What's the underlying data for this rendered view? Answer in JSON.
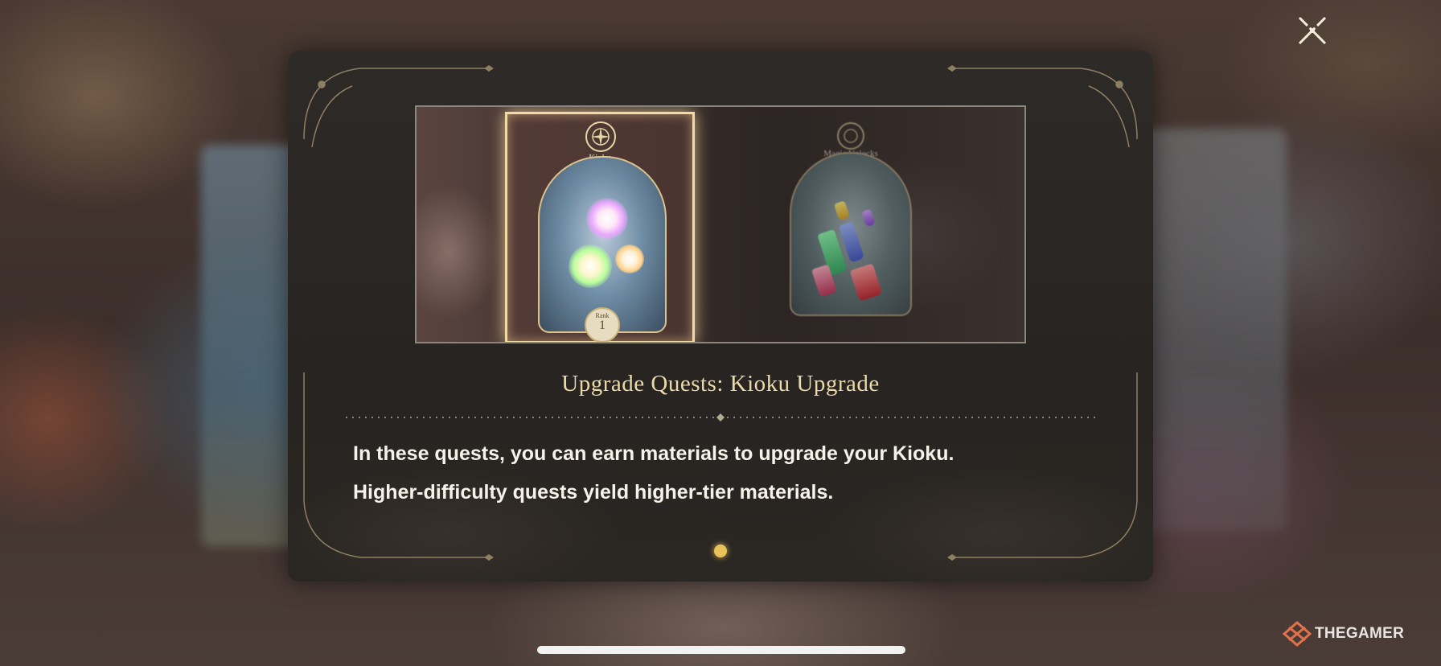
{
  "dialog": {
    "close_icon": "close-x-icon",
    "images": {
      "active_card": {
        "title": "Kioku",
        "rank_label": "Rank",
        "rank_value": "1"
      },
      "faded_card": {
        "title": "Magic Unlocks"
      }
    },
    "quest_title": "Upgrade Quests: Kioku Upgrade",
    "description": [
      "In these quests, you can earn materials to upgrade your Kioku.",
      "Higher-difficulty quests yield higher-tier materials."
    ],
    "pagination": {
      "current_page": 1,
      "total_pages": 1
    }
  },
  "watermark": {
    "text": "THEGAMER"
  },
  "colors": {
    "accent_gold": "#ecd9a8",
    "panel_bg": "#2a2622",
    "page_dot": "#e9c35a"
  }
}
